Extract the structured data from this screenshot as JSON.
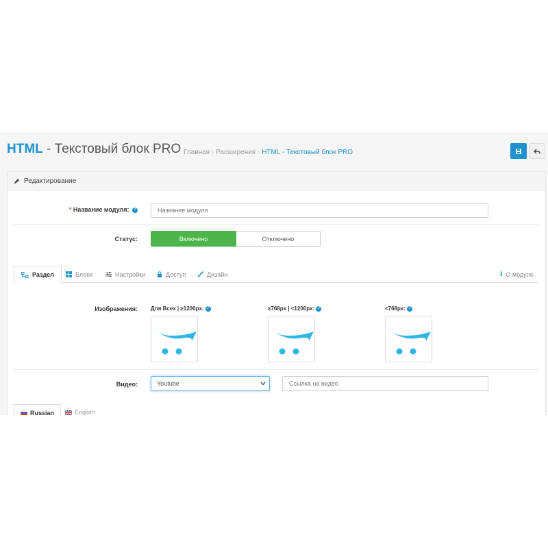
{
  "header": {
    "title_highlight": "HTML",
    "title_rest": " - Текстовый блок PRO",
    "breadcrumb": [
      "Главная",
      "Расширения",
      "HTML - Текстовый блок PRO"
    ]
  },
  "panel": {
    "heading": "Редактирование"
  },
  "form": {
    "module_name": {
      "required_mark": "*",
      "label": "Название модуля:",
      "placeholder": "Название модуля",
      "value": ""
    },
    "status": {
      "label": "Статус:",
      "on_label": "Включено",
      "off_label": "Отключено",
      "selected": "Включено"
    }
  },
  "tabs": {
    "items": [
      {
        "label": "Раздел",
        "icon": "sitemap-icon",
        "active": true
      },
      {
        "label": "Блоки",
        "icon": "th-large-icon",
        "active": false
      },
      {
        "label": "Настройки",
        "icon": "sliders-icon",
        "active": false
      },
      {
        "label": "Доступ",
        "icon": "lock-icon",
        "active": false
      },
      {
        "label": "Дизайн",
        "icon": "paint-brush-icon",
        "active": false
      }
    ],
    "about": {
      "label": "О модуле",
      "icon": "info-icon"
    }
  },
  "images": {
    "label": "Изображения:",
    "columns": [
      {
        "label": "Для Всех | ≥1200px:"
      },
      {
        "label": "≥768px | <1200px:"
      },
      {
        "label": "<768px:"
      }
    ]
  },
  "video": {
    "label": "Видео:",
    "selected": "Youtube",
    "link_placeholder": "Ссылка на видео"
  },
  "languages": [
    {
      "label": "Russian",
      "active": true
    },
    {
      "label": "English",
      "active": false
    }
  ],
  "colors": {
    "accent": "#1e91cf",
    "success": "#4cb64c",
    "cart_logo": "#2fb6e6"
  }
}
